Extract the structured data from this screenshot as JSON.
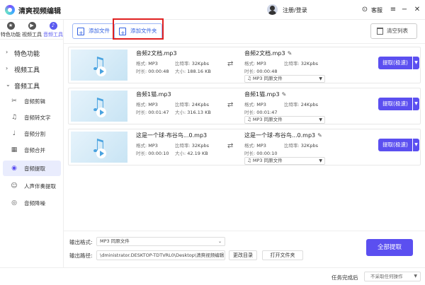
{
  "app": {
    "title": "清爽视频编辑",
    "login": "注册/登录",
    "support": "客服"
  },
  "top_tabs": [
    {
      "label": "特色功能",
      "icon": "star-icon"
    },
    {
      "label": "视频工具",
      "icon": "video-icon"
    },
    {
      "label": "音频工具",
      "icon": "audio-icon"
    }
  ],
  "sidebar": {
    "groups": [
      "特色功能",
      "视频工具",
      "音频工具"
    ],
    "items": [
      {
        "label": "音频剪辑",
        "icon": "audio-cut-icon"
      },
      {
        "label": "音频转文字",
        "icon": "audio-to-text-icon"
      },
      {
        "label": "音频分割",
        "icon": "audio-split-icon"
      },
      {
        "label": "音频合并",
        "icon": "audio-merge-icon"
      },
      {
        "label": "音频提取",
        "icon": "audio-extract-icon"
      },
      {
        "label": "人声伴奏提取",
        "icon": "vocal-icon"
      },
      {
        "label": "音频降噪",
        "icon": "denoise-icon"
      }
    ]
  },
  "toolbar": {
    "add_file": "添加文件",
    "add_folder": "添加文件夹",
    "clear_list": "清空列表"
  },
  "labels": {
    "format": "格式:",
    "bitrate": "比特率:",
    "duration": "时长:",
    "size": "大小:"
  },
  "files": [
    {
      "name": "音频2文档.mp3",
      "format": "MP3",
      "bitrate": "32Kpbs",
      "duration": "00:00:48",
      "size": "188.16 KB",
      "out_name": "音频2文档.mp3",
      "out_format": "MP3",
      "out_bitrate": "32Kpbs",
      "out_duration": "00:00:48",
      "out_select": "MP3   同原文件"
    },
    {
      "name": "音频1猫.mp3",
      "format": "MP3",
      "bitrate": "24Kpbs",
      "duration": "00:01:47",
      "size": "316.13 KB",
      "out_name": "音频1猫.mp3",
      "out_format": "MP3",
      "out_bitrate": "24Kpbs",
      "out_duration": "00:01:47",
      "out_select": "MP3   同原文件"
    },
    {
      "name": "这是一个球-布谷鸟...0.mp3",
      "format": "MP3",
      "bitrate": "32Kpbs",
      "duration": "00:00:10",
      "size": "42.19 KB",
      "out_name": "这是一个球-布谷鸟...0.mp3",
      "out_format": "MP3",
      "out_bitrate": "32Kpbs",
      "out_duration": "00:00:10",
      "out_select": "MP3   同原文件"
    }
  ],
  "extract_button": "提取(极速)",
  "bottom": {
    "format_label": "输出格式:",
    "format_value": "MP3   同原文件",
    "path_label": "输出路径:",
    "path_value": "\\dministrator.DESKTOP-TDTVRL0\\Desktop\\清爽视频编辑",
    "change_dir": "更改目录",
    "open_folder": "打开文件夹",
    "extract_all": "全部提取"
  },
  "status": {
    "label": "任务完成后",
    "select": "不采取任何操作"
  },
  "colors": {
    "accent": "#5b4ff0",
    "highlight_border": "#e02020"
  }
}
